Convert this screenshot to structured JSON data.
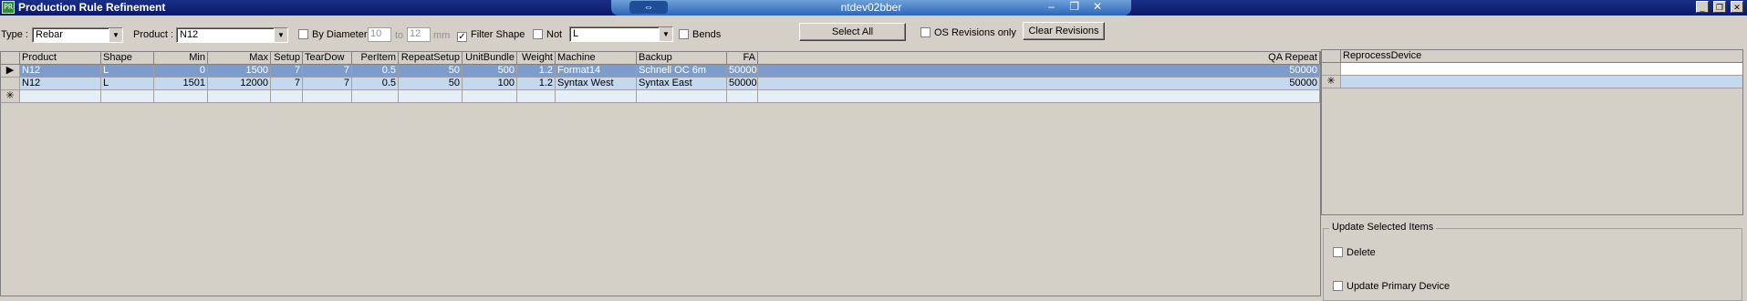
{
  "window": {
    "app_icon_text": "PR",
    "title": "Production Rule Refinement",
    "remote_host": "ntdev02bber",
    "remote_pin_icon": "pin-icon",
    "remote_controls": [
      "–",
      "❐",
      "✕"
    ],
    "controls": [
      "_",
      "❐",
      "✕"
    ]
  },
  "toolbar": {
    "type_label": "Type :",
    "type_value": "Rebar",
    "product_label": "Product :",
    "product_value": "N12",
    "by_diameter_label": "By Diameter",
    "diameter_from": "10",
    "to_label": "to",
    "diameter_to": "12",
    "mm_label": "mm",
    "filter_shape_label": "Filter Shape",
    "filter_shape_checked": "✓",
    "not_label": "Not",
    "shape_value": "L",
    "bends_label": "Bends",
    "select_all_label": "Select All",
    "os_revisions_label": "OS Revisions only",
    "clear_revisions_label": "Clear Revisions"
  },
  "grid": {
    "columns": [
      "Product",
      "Shape",
      "Min",
      "Max",
      "Setup",
      "TearDow",
      "PerItem",
      "RepeatSetup",
      "UnitBundle",
      "Weight",
      "Machine",
      "Backup",
      "FA",
      "QA Repeat"
    ],
    "rows": [
      {
        "marker": "▶",
        "cells": [
          "N12",
          "L",
          "0",
          "1500",
          "7",
          "7",
          "0.5",
          "50",
          "500",
          "1.2",
          "Format14",
          "Schnell OC 6m",
          "50000",
          "50000"
        ]
      },
      {
        "marker": "",
        "cells": [
          "N12",
          "L",
          "1501",
          "12000",
          "7",
          "7",
          "0.5",
          "50",
          "100",
          "1.2",
          "Syntax West",
          "Syntax East",
          "50000",
          "50000"
        ]
      }
    ],
    "new_row_marker": "✳"
  },
  "right_grid": {
    "column": "ReprocessDevice",
    "new_row_marker": "✳"
  },
  "update_group": {
    "legend": "Update Selected Items",
    "delete_label": "Delete",
    "update_primary_label": "Update Primary Device"
  }
}
